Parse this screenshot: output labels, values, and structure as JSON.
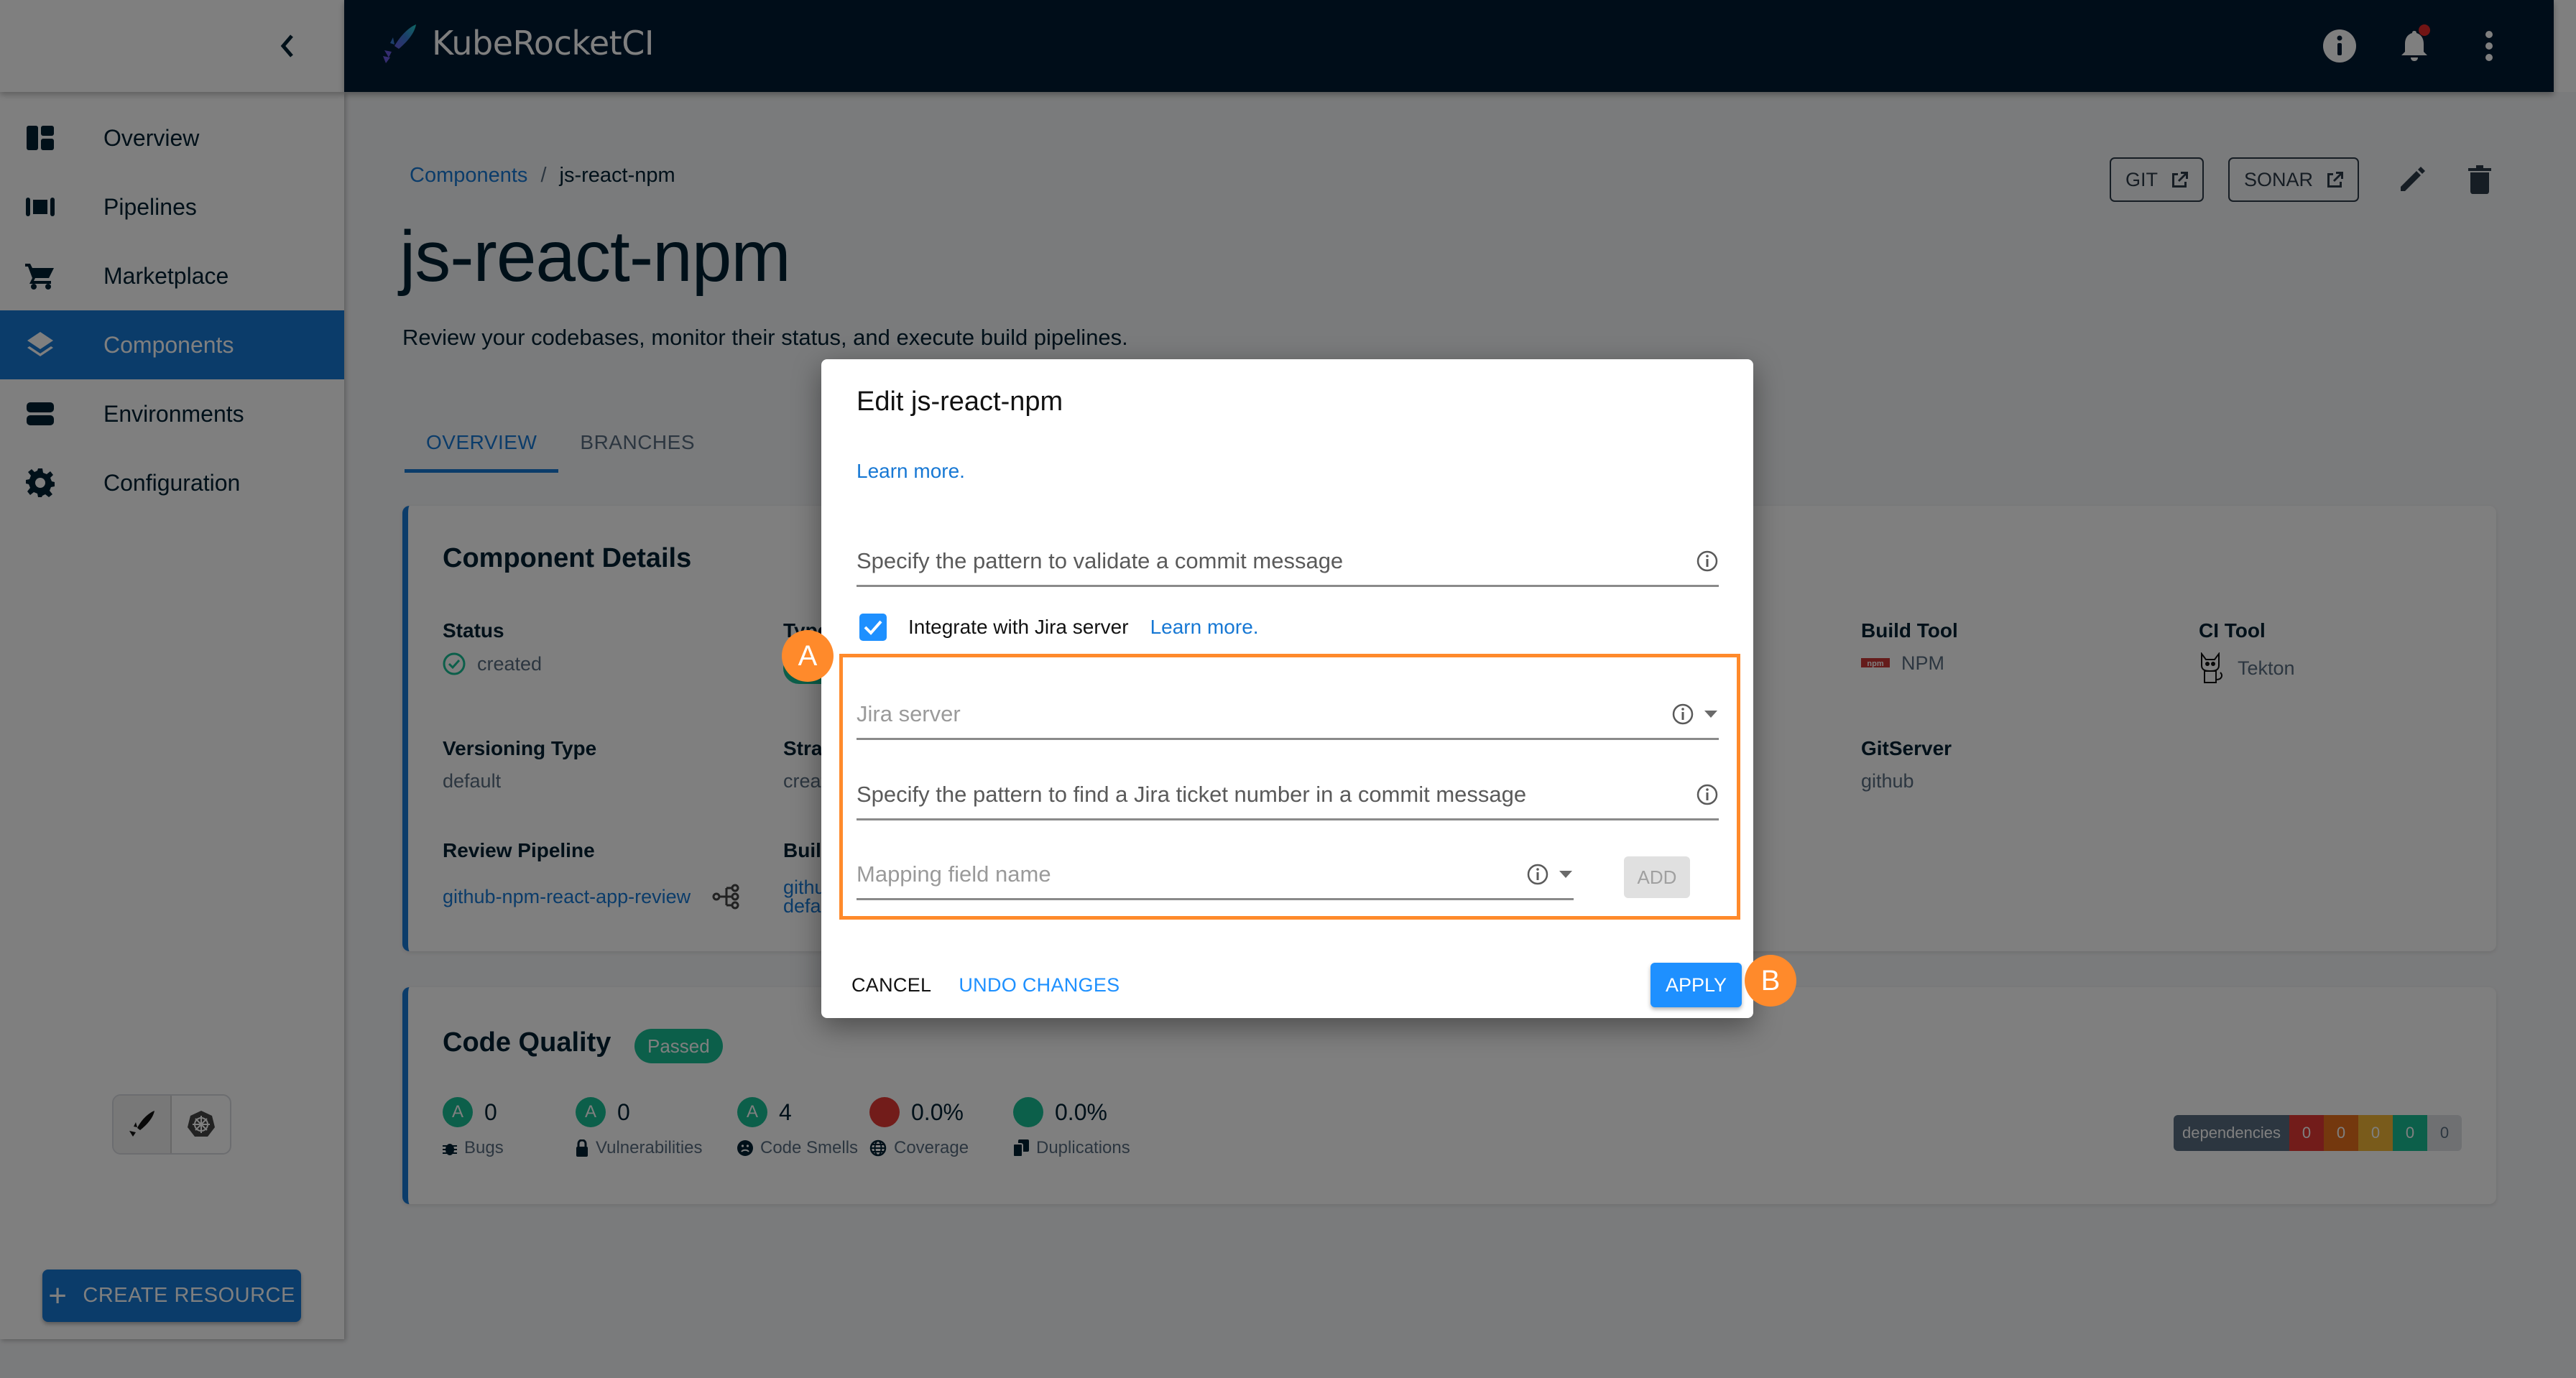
{
  "app": {
    "name": "KubeRocketCI",
    "notification_badge": true
  },
  "header_icons": [
    "info-icon",
    "bell-icon",
    "more-vert-icon"
  ],
  "sidebar": {
    "items": [
      {
        "label": "Overview",
        "icon": "dashboard-icon",
        "active": false
      },
      {
        "label": "Pipelines",
        "icon": "pipelines-icon",
        "active": false
      },
      {
        "label": "Marketplace",
        "icon": "cart-icon",
        "active": false
      },
      {
        "label": "Components",
        "icon": "layers-icon",
        "active": true
      },
      {
        "label": "Environments",
        "icon": "environments-icon",
        "active": false
      },
      {
        "label": "Configuration",
        "icon": "gear-icon",
        "active": false
      }
    ],
    "mode_toggle": [
      {
        "icon": "rocket-icon",
        "active": true
      },
      {
        "icon": "kubernetes-icon",
        "active": false
      }
    ],
    "create_button": "CREATE RESOURCE"
  },
  "breadcrumb": {
    "parent": "Components",
    "separator": "/",
    "current": "js-react-npm"
  },
  "page": {
    "title": "js-react-npm",
    "description": "Review your codebases, monitor their status, and execute build pipelines.",
    "actions": {
      "git": "GIT",
      "sonar": "SONAR"
    },
    "tabs": [
      {
        "label": "OVERVIEW",
        "active": true
      },
      {
        "label": "BRANCHES",
        "active": false
      }
    ]
  },
  "component_details": {
    "title": "Component Details",
    "fields": {
      "status": {
        "label": "Status",
        "value": "created"
      },
      "type": {
        "label": "Type"
      },
      "build_tool": {
        "label": "Build Tool",
        "value": "NPM"
      },
      "ci_tool": {
        "label": "CI Tool",
        "value": "Tekton"
      },
      "versioning_type": {
        "label": "Versioning Type",
        "value": "default"
      },
      "strategy": {
        "label": "Strat",
        "value": "creat"
      },
      "git_server": {
        "label": "GitServer",
        "value": "github"
      },
      "review_pipeline": {
        "label": "Review Pipeline",
        "value": "github-npm-react-app-review"
      },
      "build_pipeline": {
        "label": "Buil",
        "value_line1": "githu",
        "value_line2": "defa"
      }
    }
  },
  "code_quality": {
    "title": "Code Quality",
    "badge": "Passed",
    "metrics": [
      {
        "grade": "A",
        "value": "0",
        "label": "Bugs",
        "icon": "bug-icon",
        "color": "#18be94"
      },
      {
        "grade": "A",
        "value": "0",
        "label": "Vulnerabilities",
        "icon": "lock-icon",
        "color": "#18be94"
      },
      {
        "grade": "A",
        "value": "4",
        "label": "Code Smells",
        "icon": "sad-face-icon",
        "color": "#18be94"
      },
      {
        "grade": "",
        "value": "0.0%",
        "label": "Coverage",
        "icon": "globe-icon",
        "color": "#e53935"
      },
      {
        "grade": "",
        "value": "0.0%",
        "label": "Duplications",
        "icon": "copy-icon",
        "color": "#18be94"
      }
    ],
    "dependencies": {
      "label": "dependencies",
      "counts": [
        {
          "value": "0",
          "color": "#e53935"
        },
        {
          "value": "0",
          "color": "#e8711c"
        },
        {
          "value": "0",
          "color": "#f2b736"
        },
        {
          "value": "0",
          "color": "#18be94"
        },
        {
          "value": "0",
          "color": "#dfe1e5"
        }
      ]
    }
  },
  "dialog": {
    "title": "Edit js-react-npm",
    "learn_more_top": "Learn more.",
    "commit_pattern_placeholder": "Specify the pattern to validate a commit message",
    "commit_pattern_value": "",
    "jira_checkbox": {
      "label": "Integrate with Jira server",
      "checked": true,
      "learn_more": "Learn more."
    },
    "jira_server_placeholder": "Jira server",
    "jira_server_value": "",
    "ticket_pattern_placeholder": "Specify the pattern to find a Jira ticket number in a commit message",
    "ticket_pattern_value": "",
    "mapping_field_placeholder": "Mapping field name",
    "mapping_field_value": "",
    "add_button": "ADD",
    "cancel_button": "CANCEL",
    "undo_button": "UNDO CHANGES",
    "apply_button": "APPLY"
  },
  "annotations": {
    "marker_a": "A",
    "marker_b": "B",
    "accent": "#ff8a2b"
  },
  "colors": {
    "appbar": "#001a33",
    "primary": "#1778d4",
    "dialog_primary": "#1e90ff",
    "success": "#18be94"
  }
}
